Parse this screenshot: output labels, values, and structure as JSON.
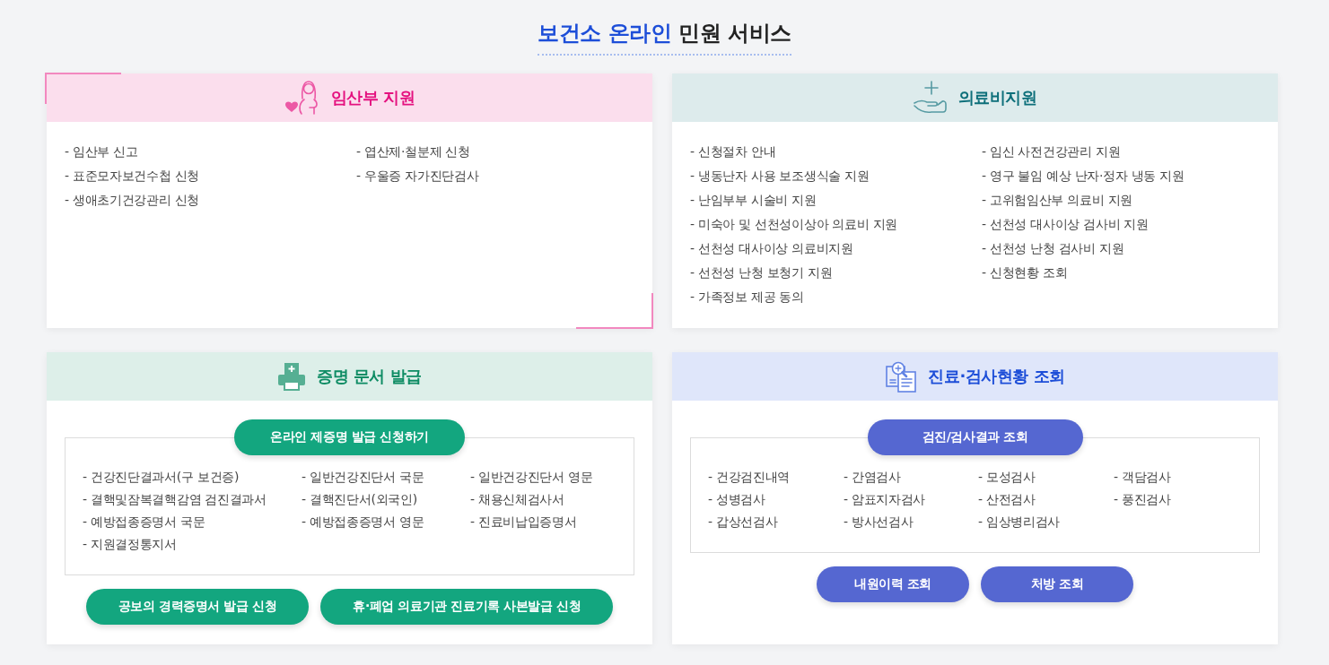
{
  "title": {
    "accent": "보건소 온라인",
    "text": "민원 서비스"
  },
  "cards": [
    {
      "kind": "list",
      "title": "임산부 지원",
      "color": "#e4117f",
      "highlighted": true,
      "rows": [
        [
          "- 임산부 신고",
          "- 엽산제·철분제 신청"
        ],
        [
          "- 표준모자보건수첩 신청",
          "- 우울증 자가진단검사"
        ],
        [
          "- 생애초기건강관리 신청"
        ]
      ]
    },
    {
      "kind": "list",
      "title": "의료비지원",
      "color": "#0d6f7a",
      "highlighted": false,
      "rows": [
        [
          "- 신청절차 안내",
          "- 임신 사전건강관리 지원"
        ],
        [
          "- 냉동난자 사용 보조생식술 지원",
          "- 영구 불임 예상 난자·정자 냉동 지원"
        ],
        [
          "- 난임부부 시술비 지원",
          "- 고위험임산부 의료비 지원"
        ],
        [
          "- 미숙아 및 선천성이상아 의료비 지원",
          "- 선천성 대사이상 검사비 지원"
        ],
        [
          "- 선천성 대사이상 의료비지원",
          "- 선천성 난청 검사비 지원"
        ],
        [
          "- 선천성 난청 보청기 지원",
          "- 신청현황 조회"
        ],
        [
          "- 가족정보 제공 동의"
        ]
      ]
    },
    {
      "kind": "panel",
      "title": "증명 문서 발급",
      "color": "#0e8c64",
      "highlighted": false,
      "main_button": {
        "label": "온라인 제증명 발급 신청하기",
        "color": "#13a67f"
      },
      "rows": [
        [
          "- 건강진단결과서(구 보건증)",
          "- 일반건강진단서 국문",
          "- 일반건강진단서 영문"
        ],
        [
          "- 결핵및잠복결핵감염 검진결과서",
          "- 결핵진단서(외국인)",
          "- 채용신체검사서"
        ],
        [
          "- 예방접종증명서 국문",
          "- 예방접종증명서 영문",
          "- 진료비납입증명서"
        ],
        [
          "- 지원결정통지서"
        ]
      ],
      "buttons": [
        {
          "label": "공보의 경력증명서 발급 신청",
          "color": "#13a67f"
        },
        {
          "label": "휴·폐업 의료기관 진료기록 사본발급 신청",
          "color": "#13a67f"
        }
      ]
    },
    {
      "kind": "panel",
      "title": "진료·검사현황 조회",
      "color": "#1d4ed8",
      "highlighted": false,
      "main_button": {
        "label": "검진/검사결과 조회",
        "color": "#5567d1"
      },
      "rows": [
        [
          "- 건강검진내역",
          "- 간염검사",
          "- 모성검사",
          "- 객담검사"
        ],
        [
          "- 성병검사",
          "- 암표지자검사",
          "- 산전검사",
          "- 풍진검사"
        ],
        [
          "- 갑상선검사",
          "- 방사선검사",
          "- 임상병리검사"
        ]
      ],
      "buttons": [
        {
          "label": "내원이력 조회",
          "color": "#5567d1"
        },
        {
          "label": "처방 조회",
          "color": "#5567d1"
        }
      ]
    }
  ]
}
